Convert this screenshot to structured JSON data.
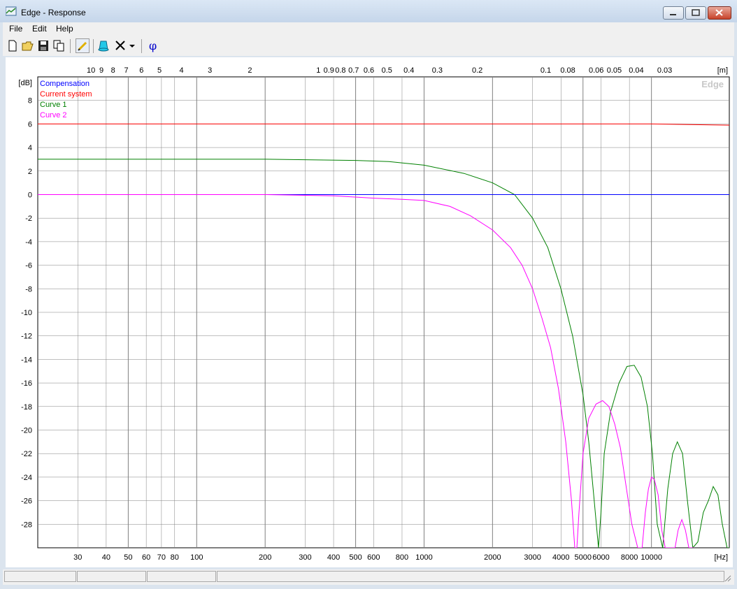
{
  "window": {
    "title": "Edge - Response"
  },
  "menu": {
    "file": "File",
    "edit": "Edit",
    "help": "Help"
  },
  "toolbar": {
    "phi_label": "φ"
  },
  "chart": {
    "watermark": "Edge",
    "colors": {
      "compensation": "#0000ff",
      "current": "#ff0000",
      "curve1": "#008000",
      "curve2": "#ff00ff",
      "grid": "#808080",
      "zero": "#000000"
    }
  },
  "chart_data": {
    "type": "line",
    "xlabel": "[Hz]",
    "ylabel": "[dB]",
    "top_axis_label": "[m]",
    "x_scale": "log",
    "xlim": [
      20,
      22000
    ],
    "ylim": [
      -30,
      10
    ],
    "x_ticks": [
      30,
      40,
      50,
      60,
      70,
      80,
      100,
      200,
      300,
      400,
      500,
      600,
      800,
      1000,
      2000,
      3000,
      4000,
      5000,
      6000,
      8000,
      10000
    ],
    "x_tick_labels": [
      "30",
      "40",
      "50",
      "60",
      "70",
      "80",
      "100",
      "200",
      "300",
      "400",
      "500",
      "600",
      "800",
      "1000",
      "2000",
      "3000",
      "4000",
      "5000",
      "6000",
      "8000",
      "10000"
    ],
    "y_ticks": [
      8,
      6,
      4,
      2,
      0,
      -2,
      -4,
      -6,
      -8,
      -10,
      -12,
      -14,
      -16,
      -18,
      -20,
      -22,
      -24,
      -26,
      -28
    ],
    "y_tick_labels": [
      "8",
      "6",
      "4",
      "2",
      "0",
      "-2",
      "-4",
      "-6",
      "-8",
      "-10",
      "-12",
      "-14",
      "-16",
      "-18",
      "-20",
      "-22",
      "-24",
      "-26",
      "-28"
    ],
    "top_ticks": [
      10,
      9,
      8,
      7,
      6,
      5,
      4,
      3,
      2,
      1,
      0.9,
      0.8,
      0.7,
      0.6,
      0.5,
      0.4,
      0.3,
      0.2,
      0.1,
      0.08,
      0.06,
      0.05,
      0.04,
      0.03
    ],
    "top_tick_labels": [
      "10",
      "9",
      "8",
      "7",
      "6",
      "5",
      "4",
      "3",
      "2",
      "1",
      "0.9",
      "0.8",
      "0.7",
      "0.6",
      "0.5",
      "0.4",
      "0.3",
      "0.2",
      "0.1",
      "0.08",
      "0.06",
      "0.05",
      "0.04",
      "0.03"
    ],
    "grid": true,
    "legend_position": "top-left",
    "series": [
      {
        "name": "Compensation",
        "key": "compensation",
        "x": [
          20,
          1000,
          22000
        ],
        "y": [
          0,
          0,
          0
        ]
      },
      {
        "name": "Current system",
        "key": "current",
        "x": [
          20,
          1000,
          10000,
          22000
        ],
        "y": [
          6,
          6,
          6,
          5.9
        ]
      },
      {
        "name": "Curve 1",
        "key": "curve1",
        "x": [
          20,
          100,
          200,
          500,
          700,
          1000,
          1500,
          2000,
          2500,
          3000,
          3500,
          4000,
          4500,
          5000,
          5300,
          5600,
          5850,
          6000,
          6200,
          6600,
          7200,
          7800,
          8400,
          9000,
          9600,
          10100,
          10600,
          11200,
          11800,
          12400,
          13000,
          13700,
          14400,
          15200,
          16000,
          16900,
          17800,
          18700,
          19600,
          20500,
          21500,
          22000
        ],
        "y": [
          3,
          3,
          3,
          2.9,
          2.8,
          2.5,
          1.8,
          1.0,
          0.0,
          -2.0,
          -4.5,
          -8.0,
          -12.0,
          -17.0,
          -21.0,
          -26.0,
          -30.0,
          -27.0,
          -22.0,
          -18.5,
          -16.0,
          -14.6,
          -14.5,
          -15.5,
          -18.0,
          -22.0,
          -28.0,
          -30.0,
          -25.0,
          -22.0,
          -21.0,
          -22.0,
          -26.0,
          -30.0,
          -29.5,
          -27.0,
          -26.0,
          -24.8,
          -25.5,
          -28.0,
          -30.0,
          -30.0
        ]
      },
      {
        "name": "Curve 2",
        "key": "curve2",
        "x": [
          20,
          200,
          400,
          600,
          800,
          1000,
          1300,
          1600,
          2000,
          2400,
          2700,
          3000,
          3300,
          3600,
          3900,
          4200,
          4450,
          4600,
          4700,
          4800,
          5000,
          5300,
          5700,
          6100,
          6500,
          6900,
          7300,
          7700,
          8200,
          8700,
          9100,
          9400,
          9700,
          10000,
          10300,
          10700,
          11100,
          11500,
          11900,
          12300,
          12700,
          13100,
          13600,
          14100,
          14600,
          15000,
          15400
        ],
        "y": [
          0,
          0,
          -0.1,
          -0.3,
          -0.4,
          -0.5,
          -1.0,
          -1.8,
          -3.0,
          -4.5,
          -6.0,
          -8.0,
          -10.5,
          -13.0,
          -16.5,
          -21.0,
          -26.0,
          -30.0,
          -30.0,
          -27.0,
          -22.0,
          -19.0,
          -17.8,
          -17.5,
          -18.0,
          -19.5,
          -21.5,
          -24.5,
          -28.0,
          -30.0,
          -30.0,
          -27.0,
          -25.0,
          -24.0,
          -24.2,
          -25.5,
          -28.5,
          -30.0,
          -30.0,
          -30.0,
          -30.0,
          -28.5,
          -27.6,
          -28.5,
          -30.0,
          -30.0,
          -30.0
        ]
      }
    ]
  }
}
